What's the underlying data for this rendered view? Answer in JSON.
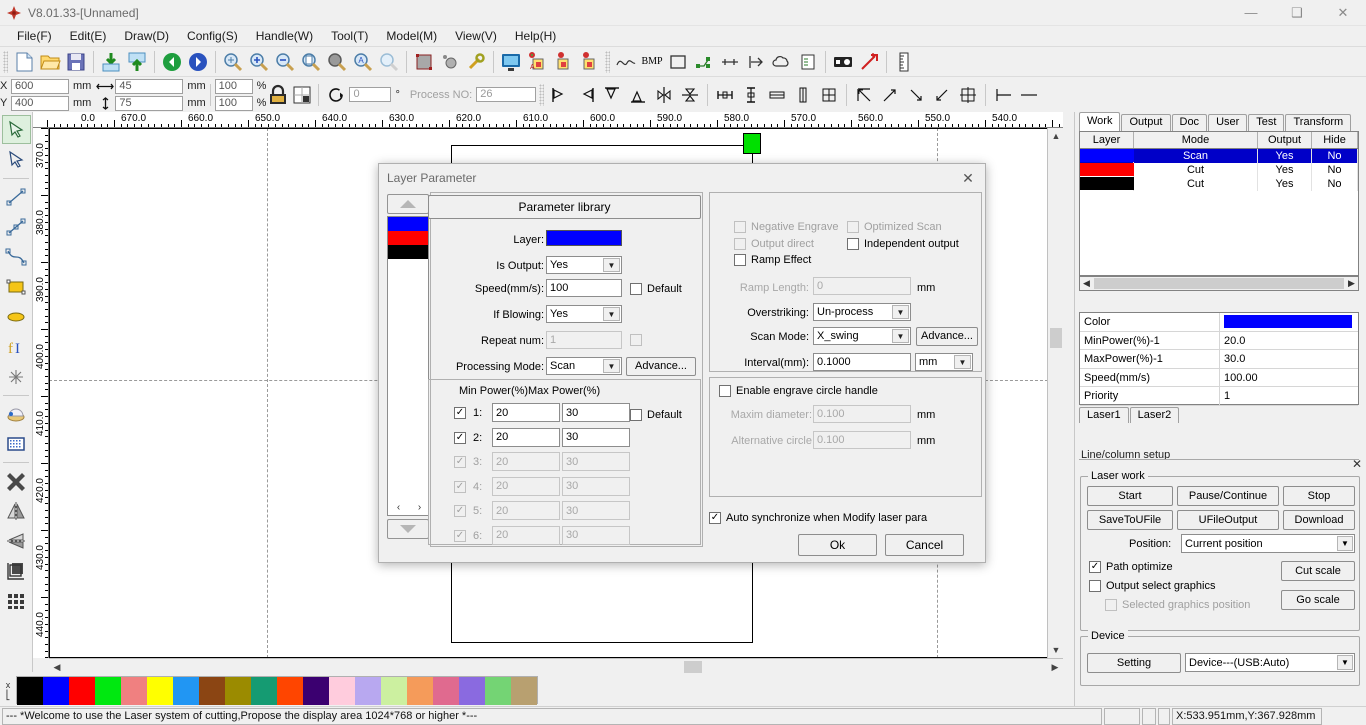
{
  "window": {
    "title": "V8.01.33-[Unnamed]",
    "minimize": "—",
    "maximize": "❑",
    "close": "✕"
  },
  "menu": {
    "items": [
      {
        "label": "File(F)"
      },
      {
        "label": "Edit(E)"
      },
      {
        "label": "Draw(D)"
      },
      {
        "label": "Config(S)"
      },
      {
        "label": "Handle(W)"
      },
      {
        "label": "Tool(T)"
      },
      {
        "label": "Model(M)"
      },
      {
        "label": "View(V)"
      },
      {
        "label": "Help(H)"
      }
    ]
  },
  "toolbar": {
    "coords": {
      "x_label": "X",
      "y_label": "Y",
      "x_value": "600",
      "y_value": "400",
      "x_unit": "mm",
      "y_unit": "mm",
      "w_value": "45",
      "h_value": "75",
      "w_unit": "mm",
      "h_unit": "mm",
      "scale_w": "100",
      "scale_h": "100",
      "pct": "%",
      "angle_value": "0",
      "angle_unit": "°",
      "process_no_label": "Process NO:",
      "process_no_value": "26"
    },
    "bmp_label": "BMP"
  },
  "rulers": {
    "horizontal": [
      "0.0",
      "670.0",
      "660.0",
      "650.0",
      "640.0",
      "630.0",
      "620.0",
      "610.0",
      "600.0",
      "590.0",
      "580.0",
      "570.0",
      "560.0",
      "550.0",
      "540.0"
    ],
    "vertical": [
      "370.0",
      "380.0",
      "390.0",
      "400.0",
      "410.0",
      "420.0",
      "430.0",
      "440.0"
    ]
  },
  "dialog": {
    "title": "Layer Parameter",
    "close": "✕",
    "parameter_library": "Parameter library",
    "layer_label": "Layer:",
    "layer_color": "#0000ff",
    "layer_strip_colors": [
      "#0000ff",
      "#ff0000",
      "#000000"
    ],
    "is_output_label": "Is Output:",
    "is_output_value": "Yes",
    "speed_label": "Speed(mm/s):",
    "speed_value": "100",
    "speed_default_label": "Default",
    "if_blowing_label": "If Blowing:",
    "if_blowing_value": "Yes",
    "repeat_num_label": "Repeat num:",
    "repeat_num_value": "1",
    "processing_mode_label": "Processing Mode:",
    "processing_mode_value": "Scan",
    "advance_label": "Advance...",
    "min_power_header": "Min Power(%)",
    "max_power_header": "Max Power(%)",
    "power_default_label": "Default",
    "power_rows": [
      {
        "index": "1:",
        "checked": true,
        "enabled": true,
        "min": "20",
        "max": "30"
      },
      {
        "index": "2:",
        "checked": true,
        "enabled": true,
        "min": "20",
        "max": "30"
      },
      {
        "index": "3:",
        "checked": true,
        "enabled": false,
        "min": "20",
        "max": "30"
      },
      {
        "index": "4:",
        "checked": true,
        "enabled": false,
        "min": "20",
        "max": "30"
      },
      {
        "index": "5:",
        "checked": true,
        "enabled": false,
        "min": "20",
        "max": "30"
      },
      {
        "index": "6:",
        "checked": true,
        "enabled": false,
        "min": "20",
        "max": "30"
      }
    ],
    "negative_engrave": "Negative Engrave",
    "optimized_scan": "Optimized Scan",
    "output_direct": "Output direct",
    "independent_output": "Independent output",
    "ramp_effect": "Ramp Effect",
    "ramp_length_label": "Ramp Length:",
    "ramp_length_value": "0",
    "ramp_length_unit": "mm",
    "overstriking_label": "Overstriking:",
    "overstriking_value": "Un-process",
    "scan_mode_label": "Scan Mode:",
    "scan_mode_value": "X_swing",
    "scan_advance_label": "Advance...",
    "interval_label": "Interval(mm):",
    "interval_value": "0.1000",
    "interval_unit": "mm",
    "enable_engrave_circle": "Enable engrave circle handle",
    "maxim_diameter_label": "Maxim diameter:",
    "maxim_diameter_value": "0.100",
    "maxim_diameter_unit": "mm",
    "alternative_circle_label": "Alternative circle",
    "alternative_circle_value": "0.100",
    "alternative_circle_unit": "mm",
    "auto_sync_label": "Auto synchronize when Modify laser para",
    "ok_label": "Ok",
    "cancel_label": "Cancel"
  },
  "right_panel": {
    "tabs": [
      {
        "label": "Work",
        "active": true
      },
      {
        "label": "Output",
        "active": false
      },
      {
        "label": "Doc",
        "active": false
      },
      {
        "label": "User",
        "active": false
      },
      {
        "label": "Test",
        "active": false
      },
      {
        "label": "Transform",
        "active": false
      }
    ],
    "layer_table": {
      "headers": [
        "Layer",
        "Mode",
        "Output",
        "Hide"
      ],
      "rows": [
        {
          "color": "#0000ff",
          "mode": "Scan",
          "output": "Yes",
          "hide": "No",
          "selected": true
        },
        {
          "color": "#ff0000",
          "mode": "Cut",
          "output": "Yes",
          "hide": "No",
          "selected": false
        },
        {
          "color": "#000000",
          "mode": "Cut",
          "output": "Yes",
          "hide": "No",
          "selected": false
        }
      ]
    },
    "properties": [
      {
        "key": "Color",
        "value": "",
        "swatch": "#0000ff"
      },
      {
        "key": "MinPower(%)-1",
        "value": "20.0",
        "swatch": ""
      },
      {
        "key": "MaxPower(%)-1",
        "value": "30.0",
        "swatch": ""
      },
      {
        "key": "Speed(mm/s)",
        "value": "100.00",
        "swatch": ""
      },
      {
        "key": "Priority",
        "value": "1",
        "swatch": ""
      }
    ],
    "laser_tabs": [
      {
        "label": "Laser1",
        "active": true
      },
      {
        "label": "Laser2",
        "active": false
      }
    ],
    "line_column_setup_label": "Line/column setup",
    "panel_close": "✕",
    "laser_work": {
      "title": "Laser work",
      "start": "Start",
      "pause_continue": "Pause/Continue",
      "stop": "Stop",
      "save_to_ufile": "SaveToUFile",
      "ufile_output": "UFileOutput",
      "download": "Download",
      "position_label": "Position:",
      "position_value": "Current position",
      "path_optimize": "Path optimize",
      "output_select_graphics": "Output select graphics",
      "selected_graphics_position": "Selected graphics position",
      "cut_scale": "Cut scale",
      "go_scale": "Go scale"
    },
    "device": {
      "title": "Device",
      "setting": "Setting",
      "device_value": "Device---(USB:Auto)"
    }
  },
  "status_bar": {
    "message": "--- *Welcome to use the Laser system of cutting,Propose the display area 1024*768 or higher *---",
    "coordinates": "X:533.951mm,Y:367.928mm"
  },
  "palette": {
    "close_label": "x",
    "colors": [
      "#000000",
      "#0000ff",
      "#ff0000",
      "#00e810",
      "#f08080",
      "#ffff00",
      "#2196f3",
      "#8b4513",
      "#9b8b00",
      "#159b72",
      "#ff4500",
      "#3b0070",
      "#ffccdd",
      "#b8a8f0",
      "#ccf0a0",
      "#f59b5a",
      "#e06a8f",
      "#8a6ae0",
      "#74d474",
      "#b8a070"
    ]
  }
}
